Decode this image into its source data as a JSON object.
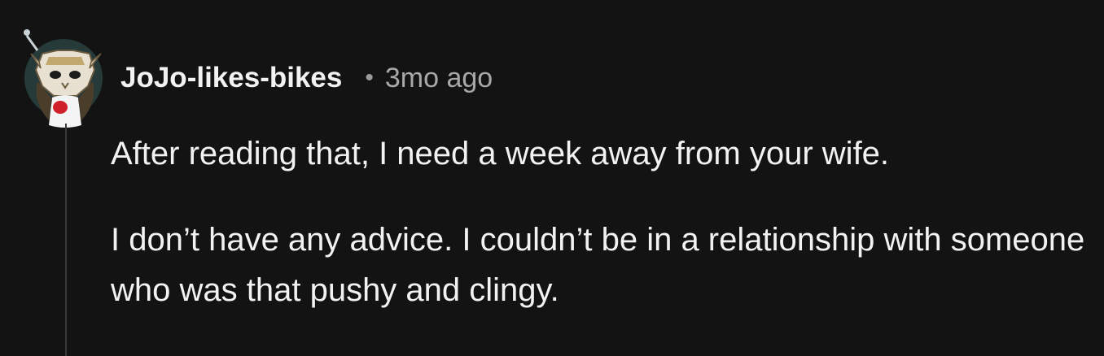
{
  "comment": {
    "author": "JoJo-likes-bikes",
    "separator": "•",
    "timestamp": "3mo ago",
    "paragraphs": [
      "After reading that, I need a week away from your wife.",
      "I don’t have any advice. I couldn’t be in a relationship with someone who was that pushy and clingy."
    ],
    "avatar_icon": "snoo-avatar-icon"
  },
  "colors": {
    "background": "#131313",
    "text": "#f2f2f2",
    "muted": "#a8a8a8",
    "thread_line": "#3a3a3a"
  }
}
